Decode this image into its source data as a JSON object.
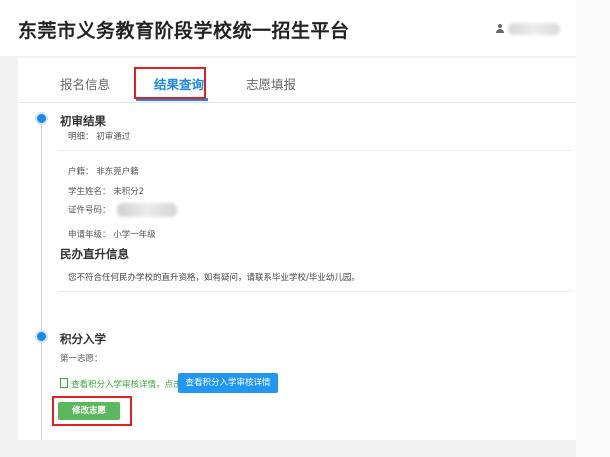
{
  "header": {
    "site_title": "东莞市义务教育阶段学校统一招生平台"
  },
  "tabs": [
    {
      "label": "报名信息",
      "active": false
    },
    {
      "label": "结果查询",
      "active": true
    },
    {
      "label": "志愿填报",
      "active": false
    }
  ],
  "first_review": {
    "title": "初审结果",
    "explain_label": "明细：",
    "explain_value": "初审通过",
    "fields": [
      {
        "label": "户籍：",
        "value": "非东莞户籍"
      },
      {
        "label": "学生姓名：",
        "value": "未积分2"
      },
      {
        "label": "证件号码：",
        "value": ""
      },
      {
        "label": "申请年级：",
        "value": "小学一年级"
      }
    ]
  },
  "private_direct": {
    "title": "民办直升信息",
    "notice": "您不符合任何民办学校的直升资格，如有疑问，请联系毕业学校/毕业幼儿园。"
  },
  "points_admission": {
    "title": "积分入学",
    "first_choice_label": "第一志愿：",
    "link_text": "查看积分入学审核详情，点击",
    "detail_button": "查看积分入学审核详情",
    "modify_button": "修改志愿"
  },
  "colors": {
    "accent": "#1e88e5",
    "highlight_box": "#e02020",
    "green": "#5cb85c"
  }
}
